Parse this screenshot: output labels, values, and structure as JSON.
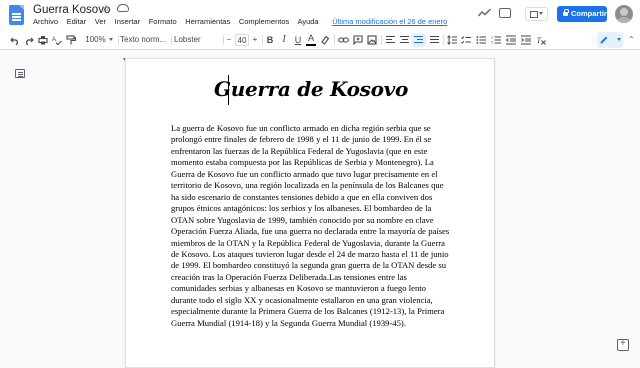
{
  "app": {
    "doc_title": "Guerra Kosovo",
    "menu": [
      "Archivo",
      "Editar",
      "Ver",
      "Insertar",
      "Formato",
      "Herramientas",
      "Complementos",
      "Ayuda"
    ],
    "last_edit": "Última modificación el 26 de enero",
    "share_label": "Compartir"
  },
  "toolbar": {
    "zoom": "100%",
    "style": "Texto norm...",
    "font": "Lobster",
    "font_size": "40",
    "bold": "B",
    "italic": "I",
    "underline": "U",
    "text_color": "A"
  },
  "document": {
    "heading": "Guerra de Kosovo",
    "body": "La guerra de Kosovo fue un conflicto armado en dicha región serbia que se prolongó entre finales de febrero de 1998 y el 11 de junio de 1999. En él se enfrentaron las fuerzas de la República Federal de Yugoslavia (que en este momento estaba compuesta por las Repúblicas de Serbia y Montenegro). La Guerra de Kosovo fue un conflicto armado que tuvo lugar precisamente en el territorio de Kosovo, una región localizada en la península de los Balcanes que ha sido escenario de constantes tensiones debido a que en ella conviven dos grupos étnicos antagónicos: los serbios y los albaneses. El bombardeo de la OTAN sobre Yugoslavia de 1999, también conocido por su nombre en clave Operación Fuerza Aliada, fue una guerra no declarada entre la mayoría de países miembros de la OTAN y la República Federal de Yugoslavia, durante la Guerra de Kosovo. Los ataques tuvieron lugar desde el 24 de marzo hasta el 11 de junio de 1999. El bombardeo constituyó la segunda gran guerra de la OTAN desde su creación tras la Operación Fuerza Deliberada.Las tensiones entre las comunidades serbias y albanesas en Kosovo se mantuvieron a fuego lento durante todo el siglo XX y ocasionalmente estallaron en una gran violencia, especialmente durante la Primera Guerra de los Balcanes (1912-13), la Primera Guerra Mundial (1914-18) y la Segunda Guerra Mundial (1939-45)."
  },
  "colors": {
    "accent": "#1a73e8",
    "page_bg": "#ffffff",
    "canvas_bg": "#f8f9fa"
  }
}
